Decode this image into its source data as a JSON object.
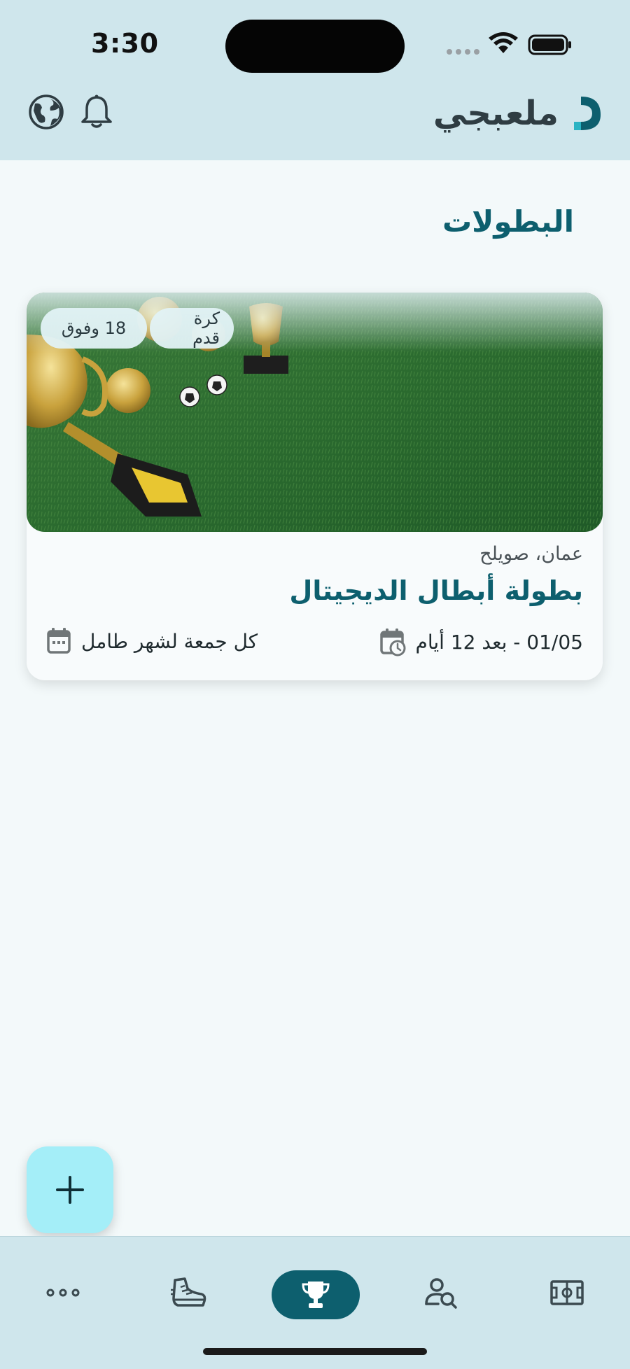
{
  "status_bar": {
    "time": "3:30"
  },
  "header": {
    "app_name": "ملعبجي"
  },
  "page": {
    "title": "البطولات"
  },
  "tournament_card": {
    "tags": {
      "sport": "كرة قدم",
      "age": "18 وفوق"
    },
    "location": "عمان، صويلح",
    "title": "بطولة أبطال الديجيتال",
    "date_text": "01/05 - بعد 12 أيام",
    "recurrence_text": "كل جمعة لشهر طامل"
  },
  "fab": {
    "icon": "plus-icon"
  },
  "bottom_nav": {
    "items": [
      {
        "icon": "more-icon",
        "active": false
      },
      {
        "icon": "sneaker-icon",
        "active": false
      },
      {
        "icon": "trophy-icon",
        "active": true
      },
      {
        "icon": "user-search-icon",
        "active": false
      },
      {
        "icon": "field-icon",
        "active": false
      }
    ]
  },
  "colors": {
    "header_bg": "#cfe6ec",
    "page_bg": "#f3f9fa",
    "accent": "#0d5f6e",
    "fab_bg": "#a4eef8"
  }
}
